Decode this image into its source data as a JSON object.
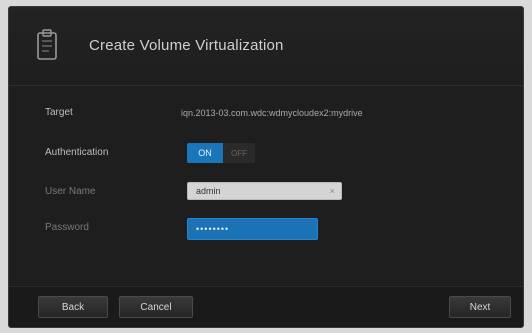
{
  "dialog": {
    "title": "Create Volume Virtualization",
    "icon": "clipboard-icon"
  },
  "form": {
    "target_label": "Target",
    "target_value": "iqn.2013-03.com.wdc:wdmycloudex2:mydrive",
    "auth_label": "Authentication",
    "auth_on_label": "ON",
    "auth_off_label": "OFF",
    "auth_state": "on",
    "username_label": "User Name",
    "username_value": "admin",
    "password_label": "Password",
    "password_value": "••••••••"
  },
  "footer": {
    "back_label": "Back",
    "cancel_label": "Cancel",
    "next_label": "Next"
  },
  "colors": {
    "accent": "#1b75bb",
    "background": "#1e1e1e"
  }
}
